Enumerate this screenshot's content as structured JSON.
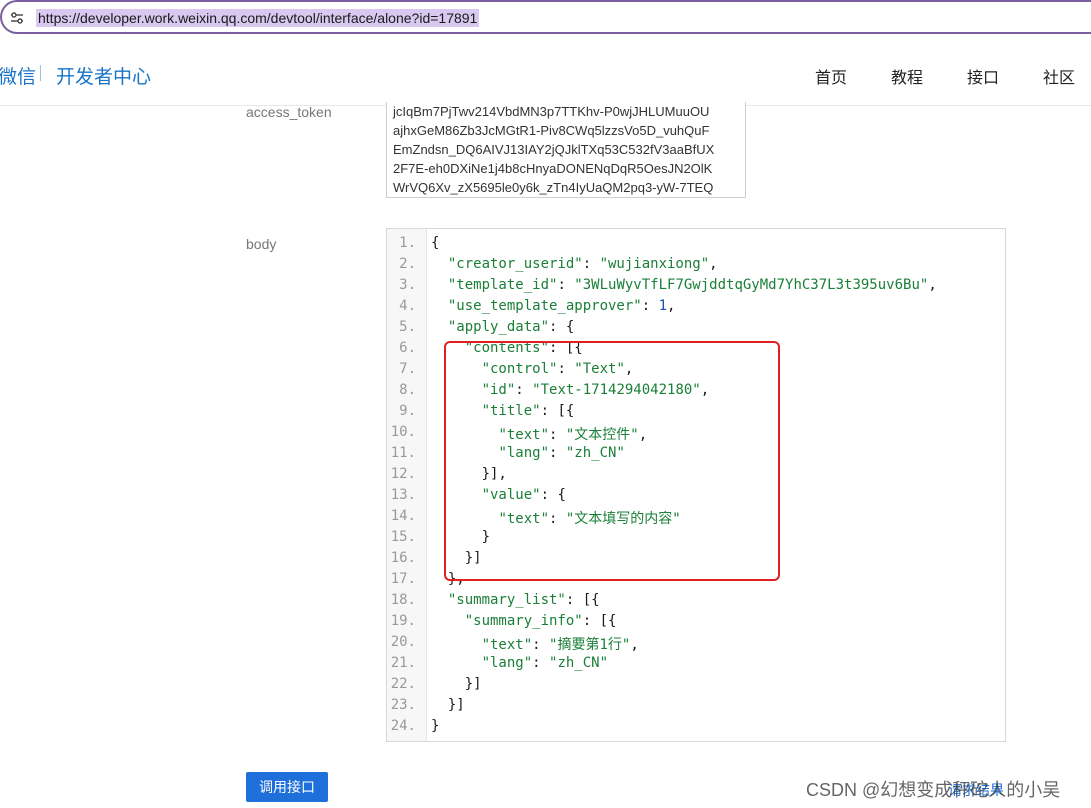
{
  "browser": {
    "url": "https://developer.work.weixin.qq.com/devtool/interface/alone?id=17891",
    "site_info_icon": "tune-icon"
  },
  "header": {
    "brand_partial": "微信",
    "brand_title": "开发者中心",
    "nav": [
      "首页",
      "教程",
      "接口",
      "社区"
    ]
  },
  "form": {
    "access_token_label": "access_token",
    "access_token_lines": [
      "jcIqBm7PjTwv214VbdMN3p7TTKhv-P0wjJHLUMuuOU",
      "ajhxGeM86Zb3JcMGtR1-Piv8CWq5lzzsVo5D_vuhQuF",
      "EmZndsn_DQ6AIVJ13IAY2jQJklTXq53C532fV3aaBfUX",
      "2F7E-eh0DXiNe1j4b8cHnyaDONENqDqR5OesJN2OlK",
      "WrVQ6Xv_zX5695le0y6k_zTn4IyUaQM2pq3-yW-7TEQ"
    ],
    "body_label": "body",
    "line_numbers": [
      "1.",
      "2.",
      "3.",
      "4.",
      "5.",
      "6.",
      "7.",
      "8.",
      "9.",
      "10.",
      "11.",
      "12.",
      "13.",
      "14.",
      "15.",
      "16.",
      "17.",
      "18.",
      "19.",
      "20.",
      "21.",
      "22.",
      "23.",
      "24."
    ],
    "code_lines": [
      "{",
      "  \"creator_userid\": \"wujianxiong\",",
      "  \"template_id\": \"3WLuWyvTfLF7GwjddtqGyMd7YhC37L3t395uv6Bu\",",
      "  \"use_template_approver\": 1,",
      "  \"apply_data\": {",
      "    \"contents\": [{",
      "      \"control\": \"Text\",",
      "      \"id\": \"Text-1714294042180\",",
      "      \"title\": [{",
      "        \"text\": \"文本控件\",",
      "        \"lang\": \"zh_CN\"",
      "      }],",
      "      \"value\": {",
      "        \"text\": \"文本填写的内容\"",
      "      }",
      "    }]",
      "  },",
      "  \"summary_list\": [{",
      "    \"summary_info\": [{",
      "      \"text\": \"摘要第1行\",",
      "      \"lang\": \"zh_CN\"",
      "    }]",
      "  }]",
      "}"
    ],
    "call_button_label": "调用接口",
    "behind_text": "请求结果"
  },
  "watermark": "CSDN @幻想变成秤砣人的小吴",
  "colors": {
    "accent": "#1a73c8",
    "button": "#1e6fd9",
    "highlight": "#e02020",
    "string": "#1a7f37",
    "number": "#1a4fbf"
  }
}
